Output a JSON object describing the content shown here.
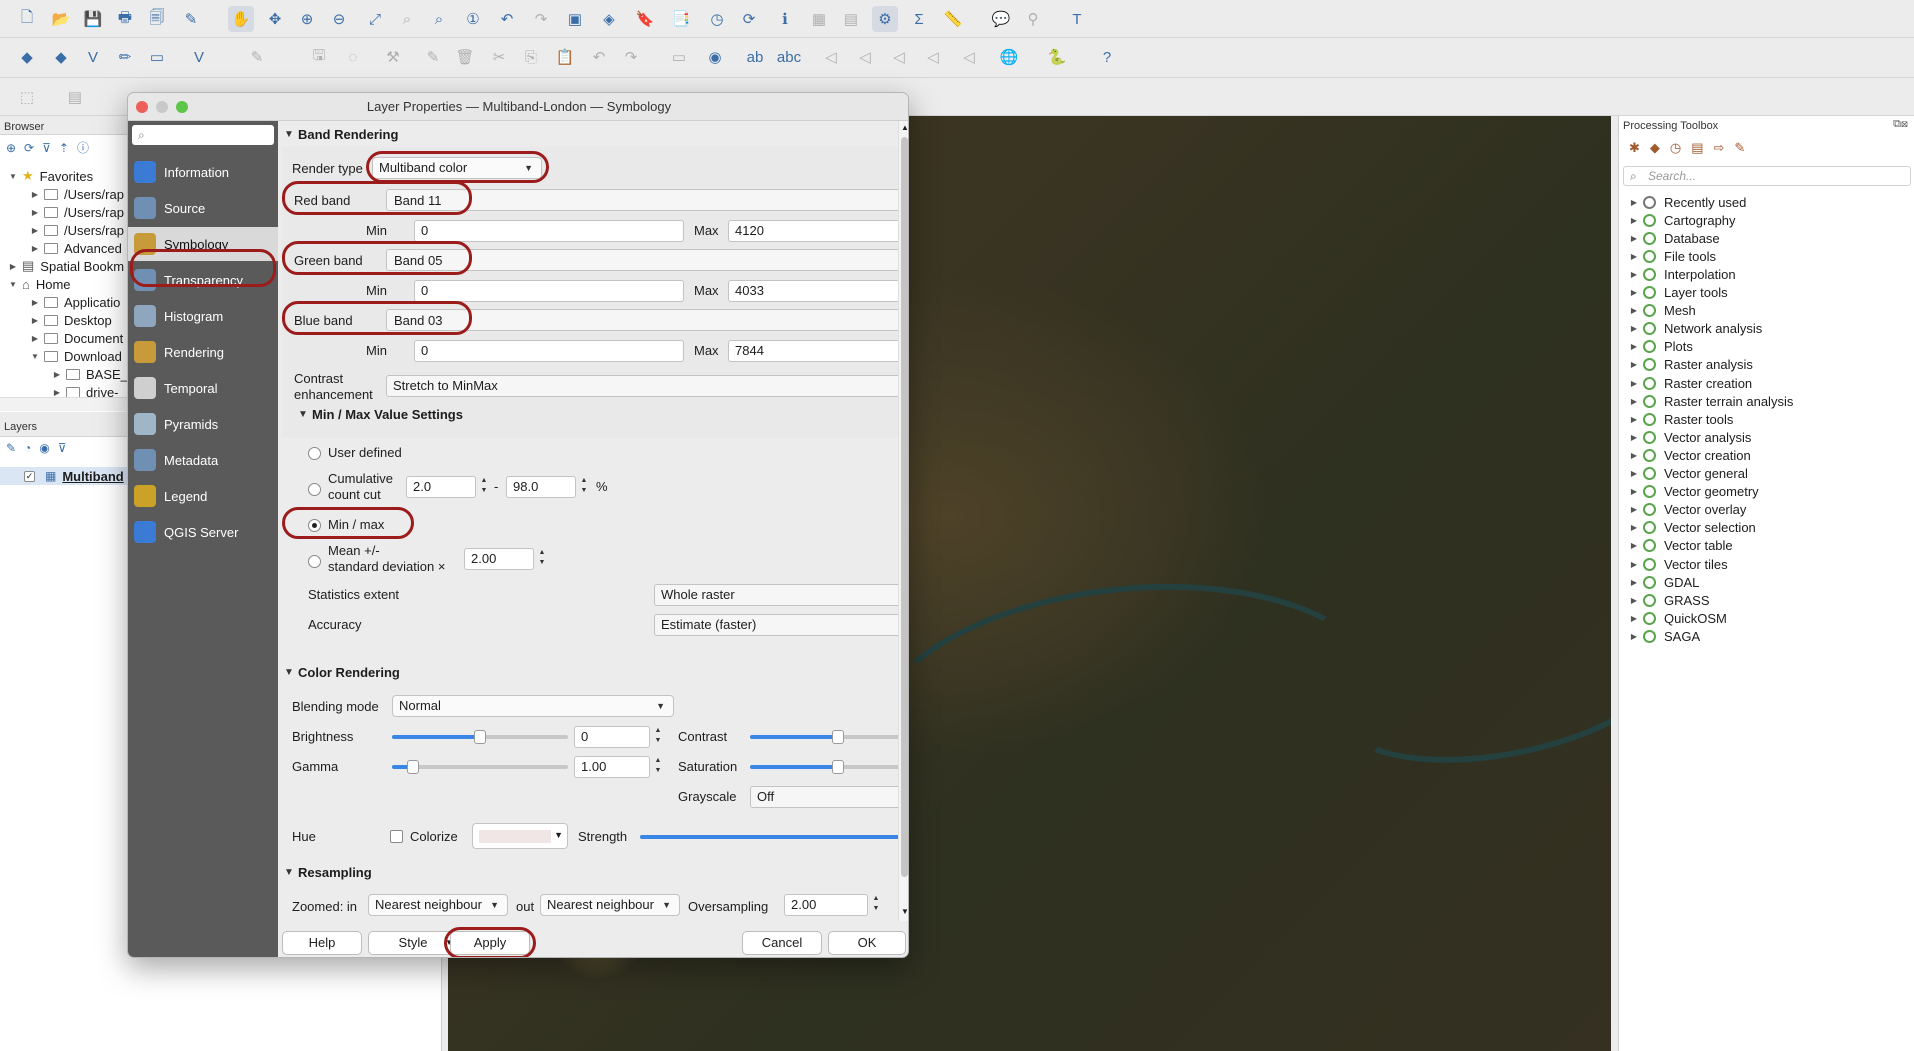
{
  "dialog": {
    "title": "Layer Properties — Multiband-London — Symbology",
    "search_placeholder": "",
    "nav": [
      {
        "label": "Information",
        "icon": "info-icon"
      },
      {
        "label": "Source",
        "icon": "source-icon"
      },
      {
        "label": "Symbology",
        "icon": "paintbrush-icon"
      },
      {
        "label": "Transparency",
        "icon": "transparency-icon"
      },
      {
        "label": "Histogram",
        "icon": "histogram-icon"
      },
      {
        "label": "Rendering",
        "icon": "rendering-brush-icon"
      },
      {
        "label": "Temporal",
        "icon": "clock-icon"
      },
      {
        "label": "Pyramids",
        "icon": "pyramid-icon"
      },
      {
        "label": "Metadata",
        "icon": "metadata-icon"
      },
      {
        "label": "Legend",
        "icon": "legend-icon"
      },
      {
        "label": "QGIS Server",
        "icon": "server-icon"
      }
    ],
    "active_nav": "Symbology",
    "band_rendering": {
      "section": "Band Rendering",
      "render_type_label": "Render type",
      "render_type": "Multiband color",
      "red_label": "Red band",
      "red_band": "Band 11",
      "red_min": "0",
      "red_max": "4120",
      "green_label": "Green band",
      "green_band": "Band 05",
      "green_min": "0",
      "green_max": "4033",
      "blue_label": "Blue band",
      "blue_band": "Band 03",
      "blue_min": "0",
      "blue_max": "7844",
      "min_label": "Min",
      "max_label": "Max",
      "contrast_label_1": "Contrast",
      "contrast_label_2": "enhancement",
      "contrast": "Stretch to MinMax"
    },
    "minmax": {
      "section": "Min / Max Value Settings",
      "user_defined": "User defined",
      "cumulative_1": "Cumulative",
      "cumulative_2": "count cut",
      "cum_low": "2.0",
      "cum_high": "98.0",
      "dash": "-",
      "percent": "%",
      "min_max": "Min / max",
      "mean_1": "Mean +/-",
      "mean_2": "standard deviation ×",
      "std": "2.00",
      "selected": "Min / max",
      "stats_extent_label": "Statistics extent",
      "stats_extent": "Whole raster",
      "accuracy_label": "Accuracy",
      "accuracy": "Estimate (faster)"
    },
    "color_rendering": {
      "section": "Color Rendering",
      "blending_label": "Blending mode",
      "blending": "Normal",
      "brightness_label": "Brightness",
      "brightness": "0",
      "brightness_level": 0.5,
      "contrast_label": "Contrast",
      "contrast_level": 0.5,
      "gamma_label": "Gamma",
      "gamma": "1.00",
      "gamma_level": 0.12,
      "saturation_label": "Saturation",
      "saturation_level": 0.5,
      "grayscale_label": "Grayscale",
      "grayscale": "Off",
      "hue_label": "Hue",
      "colorize_label": "Colorize",
      "strength_label": "Strength",
      "strength_level": 1.0
    },
    "resampling": {
      "section": "Resampling",
      "zoomed_in": "Zoomed: in",
      "in_value": "Nearest neighbour",
      "out_label": "out",
      "out_value": "Nearest neighbour",
      "oversampling_label": "Oversampling",
      "oversampling": "2.00"
    },
    "buttons": {
      "help": "Help",
      "style": "Style",
      "apply": "Apply",
      "cancel": "Cancel",
      "ok": "OK"
    }
  },
  "browser": {
    "title": "Browser",
    "items": [
      {
        "label": "Favorites",
        "indent": 0,
        "icon": "star-icon"
      },
      {
        "label": "/Users/rap",
        "indent": 1,
        "icon": "folder-icon"
      },
      {
        "label": "/Users/rap",
        "indent": 1,
        "icon": "folder-icon"
      },
      {
        "label": "/Users/rap",
        "indent": 1,
        "icon": "folder-icon"
      },
      {
        "label": "Advanced",
        "indent": 1,
        "icon": "folder-icon"
      },
      {
        "label": "Spatial Bookm",
        "indent": 0,
        "icon": "bookmark-icon"
      },
      {
        "label": "Home",
        "indent": 0,
        "icon": "home-icon"
      },
      {
        "label": "Applicatio",
        "indent": 1,
        "icon": "folder-icon"
      },
      {
        "label": "Desktop",
        "indent": 1,
        "icon": "folder-icon"
      },
      {
        "label": "Document",
        "indent": 1,
        "icon": "folder-icon"
      },
      {
        "label": "Download",
        "indent": 1,
        "icon": "folder-icon"
      },
      {
        "label": "BASE_",
        "indent": 2,
        "icon": "folder-icon"
      },
      {
        "label": "drive-",
        "indent": 2,
        "icon": "folder-icon"
      }
    ]
  },
  "layers": {
    "title": "Layers",
    "layer": "Multiband"
  },
  "processing": {
    "title": "Processing Toolbox",
    "search_placeholder": "Search...",
    "items": [
      "Recently used",
      "Cartography",
      "Database",
      "File tools",
      "Interpolation",
      "Layer tools",
      "Mesh",
      "Network analysis",
      "Plots",
      "Raster analysis",
      "Raster creation",
      "Raster terrain analysis",
      "Raster tools",
      "Vector analysis",
      "Vector creation",
      "Vector general",
      "Vector geometry",
      "Vector overlay",
      "Vector selection",
      "Vector table",
      "Vector tiles",
      "GDAL",
      "GRASS",
      "QuickOSM",
      "SAGA"
    ]
  },
  "colors": {
    "accent": "#3a86e6",
    "highlight_ring": "#9c1c1c",
    "nav_bg": "#5a5a5a",
    "nav_active": "#d9d9d9"
  }
}
